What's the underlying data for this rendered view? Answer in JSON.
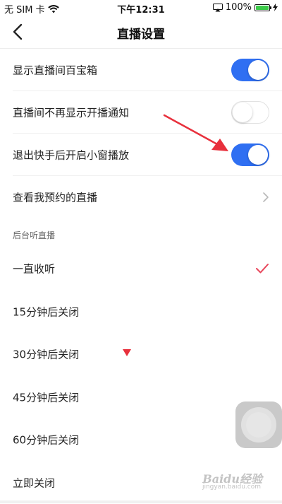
{
  "status_bar": {
    "carrier": "无 SIM 卡",
    "wifi_icon": "wifi-icon",
    "time": "下午12:31",
    "screen_mirror_icon": "airplay-icon",
    "battery_percent": "100%",
    "battery_level": 1.0,
    "battery_color": "#3ccb4a"
  },
  "nav": {
    "back_icon": "chevron-left-icon",
    "title": "直播设置"
  },
  "settings": {
    "show_treasure_box": {
      "label": "显示直播间百宝箱",
      "enabled": true
    },
    "hide_start_notice": {
      "label": "直播间不再显示开播通知",
      "enabled": false
    },
    "pip_on_exit": {
      "label": "退出快手后开启小窗播放",
      "enabled": true
    },
    "my_reservations": {
      "label": "查看我预约的直播"
    }
  },
  "background_listen": {
    "section_title": "后台听直播",
    "options": [
      {
        "label": "一直收听",
        "selected": true
      },
      {
        "label": "15分钟后关闭",
        "selected": false
      },
      {
        "label": "30分钟后关闭",
        "selected": false
      },
      {
        "label": "45分钟后关闭",
        "selected": false
      },
      {
        "label": "60分钟后关闭",
        "selected": false
      },
      {
        "label": "立即关闭",
        "selected": false
      }
    ]
  },
  "colors": {
    "toggle_on": "#2f6ff2",
    "check_mark": "#e8455a",
    "annotation_red": "#e8303c"
  },
  "watermark": {
    "text": "Baidu经验",
    "sub": "jingyan.baidu.com"
  }
}
